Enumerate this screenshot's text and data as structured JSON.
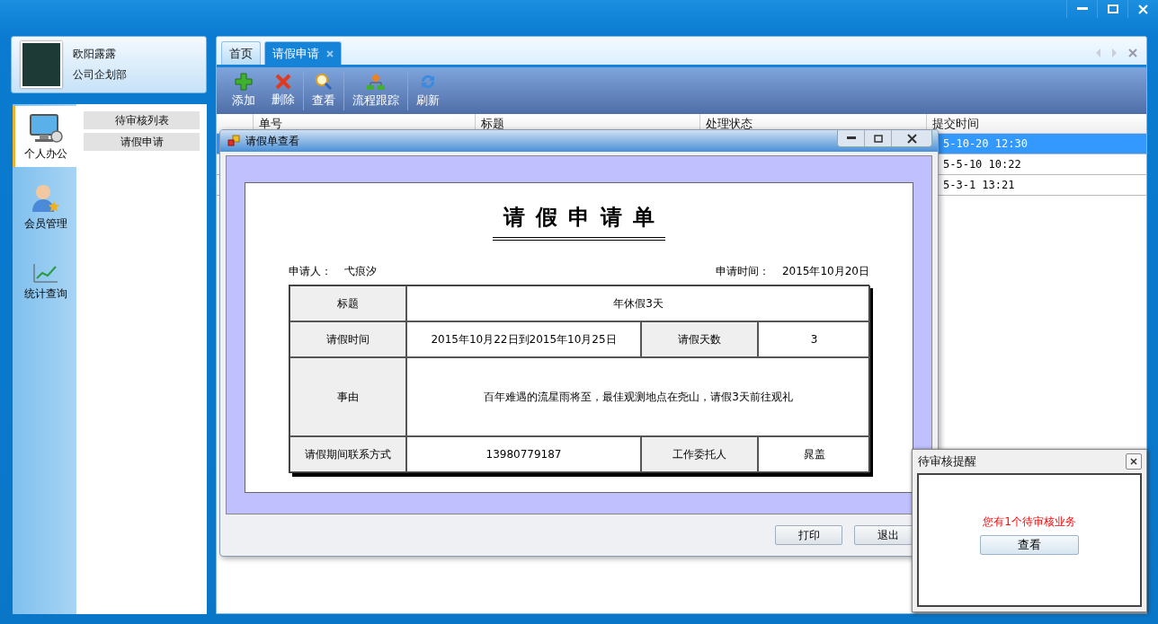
{
  "user": {
    "name": "欧阳露露",
    "department": "公司企划部"
  },
  "nav": [
    {
      "label": "个人办公",
      "kind": "computer",
      "selected": true
    },
    {
      "label": "会员管理",
      "kind": "member",
      "selected": false
    },
    {
      "label": "统计查询",
      "kind": "chart",
      "selected": false
    }
  ],
  "submenu": [
    "待审核列表",
    "请假申请"
  ],
  "tabs": [
    {
      "label": "首页",
      "selected": false,
      "closable": false
    },
    {
      "label": "请假申请",
      "selected": true,
      "closable": true
    }
  ],
  "toolbar": [
    {
      "label": "添加",
      "kind": "add"
    },
    {
      "label": "删除",
      "kind": "delete"
    },
    {
      "label": "查看",
      "kind": "view"
    },
    {
      "label": "流程跟踪",
      "kind": "flow"
    },
    {
      "label": "刷新",
      "kind": "refresh"
    }
  ],
  "table": {
    "columns": [
      "单号",
      "标题",
      "处理状态",
      "提交时间"
    ],
    "rows": [
      {
        "submitted": "5-10-20 12:30",
        "selected": true
      },
      {
        "submitted": "5-5-10 10:22",
        "selected": false
      },
      {
        "submitted": "5-3-1 13:21",
        "selected": false
      }
    ]
  },
  "dialog": {
    "title": "请假单查看",
    "form_title": "请假申请单",
    "applicant_label": "申请人：",
    "applicant": "弋痕汐",
    "date_label": "申请时间：",
    "date": "2015年10月20日",
    "rows": [
      {
        "kind": "line",
        "cells": [
          {
            "label": "标题",
            "value": "年休假3天"
          }
        ]
      },
      {
        "kind": "line",
        "cells": [
          {
            "label": "请假时间",
            "value": "2015年10月22日到2015年10月25日"
          },
          {
            "label": "请假天数",
            "value": "3"
          }
        ]
      },
      {
        "kind": "block",
        "cells": [
          {
            "label": "事由",
            "value": "百年难遇的流星雨将至，最佳观测地点在尧山，请假3天前往观礼"
          }
        ]
      },
      {
        "kind": "line",
        "cells": [
          {
            "label": "请假期间联系方式",
            "value": "13980779187"
          },
          {
            "label": "工作委托人",
            "value": "晁盖"
          }
        ]
      }
    ],
    "buttons": [
      "打印",
      "退出"
    ]
  },
  "reminder": {
    "title": "待审核提醒",
    "message": "您有1个待审核业务",
    "button": "查看"
  }
}
